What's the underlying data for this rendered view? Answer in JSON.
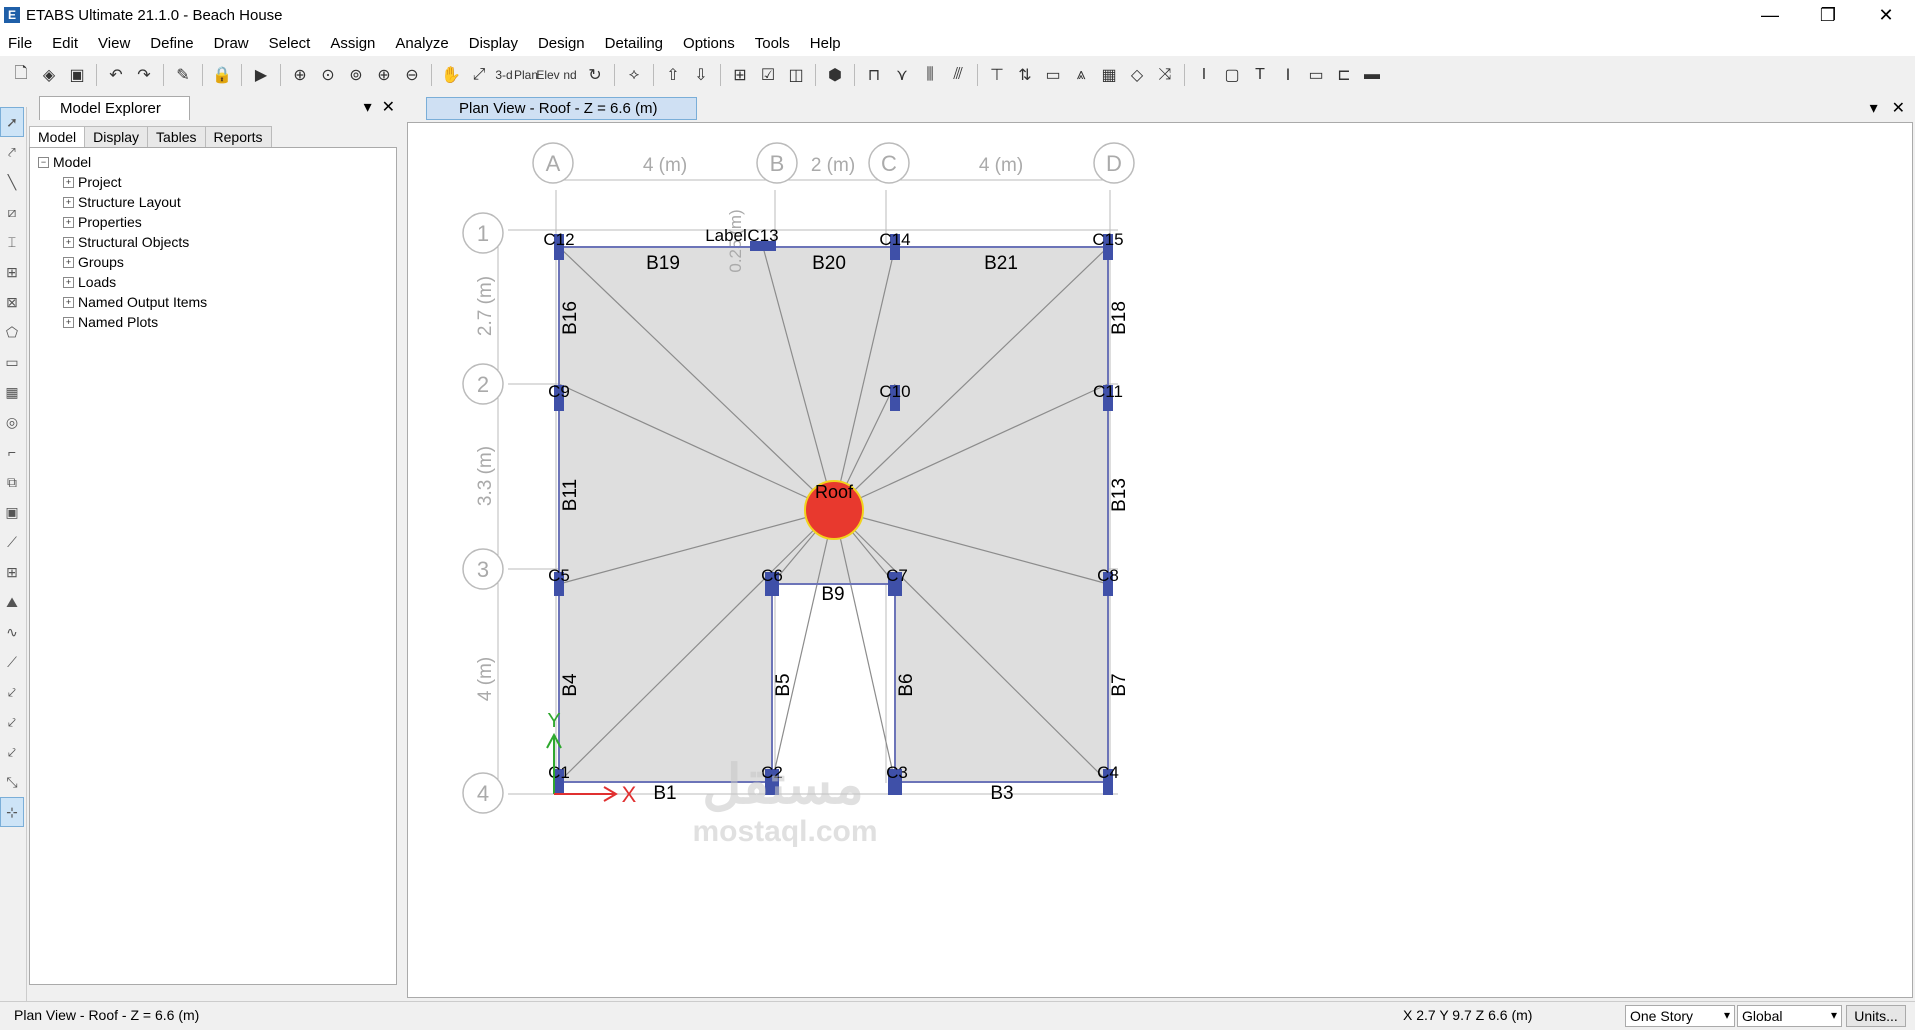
{
  "window": {
    "title": "ETABS Ultimate 21.1.0 - Beach House",
    "app_icon": "E"
  },
  "menu": [
    "File",
    "Edit",
    "View",
    "Define",
    "Draw",
    "Select",
    "Assign",
    "Analyze",
    "Display",
    "Design",
    "Detailing",
    "Options",
    "Tools",
    "Help"
  ],
  "toolbar": {
    "three_d": "3-d",
    "plan": "Plan",
    "elev": "Elev",
    "nd": "nd"
  },
  "explorer": {
    "title": "Model Explorer",
    "tabs": [
      "Model",
      "Display",
      "Tables",
      "Reports"
    ],
    "root": "Model",
    "items": [
      "Project",
      "Structure Layout",
      "Properties",
      "Structural Objects",
      "Groups",
      "Loads",
      "Named Output Items",
      "Named Plots"
    ]
  },
  "view": {
    "tab_title": "Plan View - Roof - Z = 6.6 (m)",
    "grid_x": [
      "A",
      "B",
      "C",
      "D"
    ],
    "grid_y": [
      "1",
      "2",
      "3",
      "4"
    ],
    "dims_x": [
      "4 (m)",
      "2 (m)",
      "4 (m)"
    ],
    "dims_y": [
      "2.7 (m)",
      "3.3 (m)",
      "4 (m)"
    ],
    "small_dim": "0.25 (m)",
    "label_text": "Label",
    "columns": [
      "C12",
      "C13",
      "C14",
      "C15",
      "C9",
      "C10",
      "C11",
      "C5",
      "C6",
      "C7",
      "C8",
      "C1",
      "C2",
      "C3",
      "C4"
    ],
    "beams": [
      "B19",
      "B20",
      "B21",
      "B16",
      "B18",
      "B11",
      "B13",
      "B9",
      "B4",
      "B5",
      "B6",
      "B7",
      "B1",
      "B3"
    ],
    "diaphragm_label": "Roof",
    "watermark": {
      "arabic": "مستقل",
      "latin": "mostaql.com"
    }
  },
  "status": {
    "left": "Plan View - Roof - Z = 6.6 (m)",
    "coords": "X 2.7  Y 9.7  Z 6.6 (m)",
    "story_select": "One Story",
    "coord_select": "Global",
    "units_button": "Units..."
  }
}
